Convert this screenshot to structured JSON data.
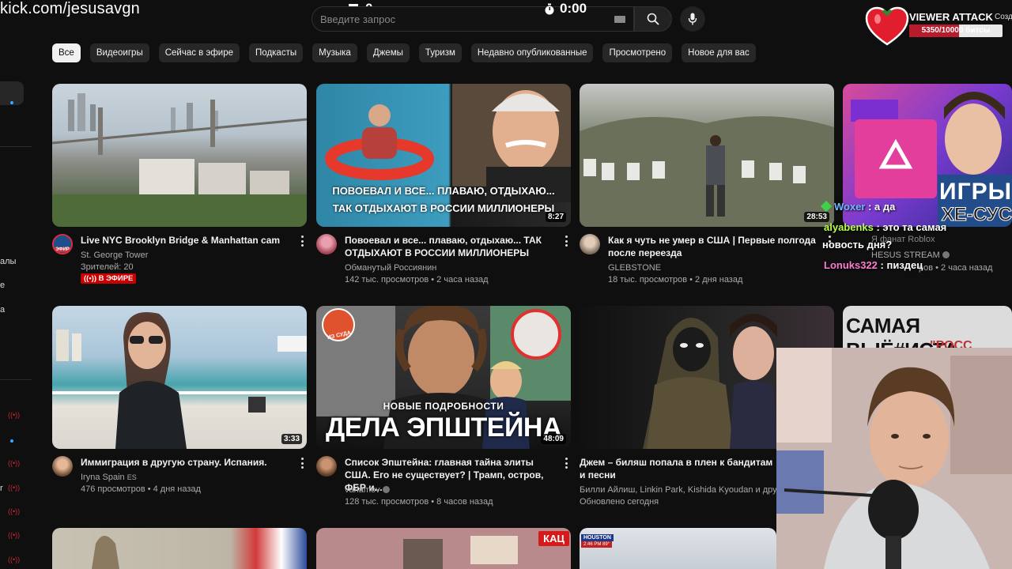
{
  "stream": {
    "channel_url": "kick.com/jesusavgn",
    "counter": "0",
    "timer": "0:00"
  },
  "search": {
    "placeholder": "Введите запрос"
  },
  "viewer_attack": {
    "title": "VIEWER ATTACK",
    "progress_text": "5350/10000 битсы",
    "progress": 0.535,
    "create_label": "Созд"
  },
  "sidebar": {
    "texts": [
      "алы",
      "е",
      "а",
      "r"
    ]
  },
  "chips": [
    "Все",
    "Видеоигры",
    "Сейчас в эфире",
    "Подкасты",
    "Музыка",
    "Джемы",
    "Туризм",
    "Недавно опубликованные",
    "Просмотрено",
    "Новое для вас"
  ],
  "videos": [
    {
      "title": "Live NYC Brooklyn Bridge & Manhattan cam",
      "channel": "St. George Tower",
      "stats": "Зрителей: 20",
      "badge": "В ЭФИРЕ",
      "avatar_badge": "ЭФИР",
      "duration": ""
    },
    {
      "title": "Повоевал и все... плаваю, отдыхаю... ТАК ОТДЫХАЮТ В РОССИИ МИЛЛИОНЕРЫ",
      "channel": "Обманутый Россиянин",
      "stats": "142 тыс. просмотров • 2 часа назад",
      "duration": "8:27",
      "overlay_line1": "ПОВОЕВАЛ И ВСЕ... ПЛАВАЮ, ОТДЫХАЮ...",
      "overlay_line2": "ТАК ОТДЫХАЮТ В РОССИИ МИЛЛИОНЕРЫ"
    },
    {
      "title": "Как я чуть не умер в США | Первые полгода после переезда",
      "channel": "GLEBSTONE",
      "stats": "18 тыс. просмотров • 2 дня назад",
      "duration": "28:53"
    },
    {
      "title": "",
      "channel": "HESUS STREAM",
      "stats": "ров • 2 часа назад",
      "category": "Я фанат Roblox",
      "overlay_line1": "ИГРЫ",
      "overlay_line2": "ХЕ-СУС"
    },
    {
      "title": "Иммиграция в другую страну. Испания.",
      "channel": "Iryna Spain",
      "channel_suffix": "ES",
      "stats": "476 просмотров • 4 дня назад",
      "duration": "3:33"
    },
    {
      "title": "Список Эпштейна: главная тайна элиты США. Его не существует? | Трамп, остров, ФБР и...",
      "channel": "varlamov",
      "stats": "128 тыс. просмотров • 8 часов назад",
      "duration": "48:09",
      "overlay_line1": "НОВЫЕ ПОДРОБНОСТИ",
      "overlay_line2": "ДЕЛА ЭПШТЕЙНА",
      "overlay_small": "ИЗ СУДА"
    },
    {
      "title": "Джем – биляш попала в плен к бандитам и песни",
      "channel": "Билли Айлиш, Linkin Park, Kishida Kyoudan и други",
      "stats": "Обновлено сегодня"
    },
    {
      "title": "",
      "overlay_line1": "САМАЯ ВЫЁ#ИСТА",
      "overlay_line2": "\"РОСС"
    },
    {
      "overlay_line1": ""
    },
    {
      "overlay_line1": "КАЦ"
    },
    {
      "overlay_line1": "HOUSTON",
      "overlay_line2": "2:46 PM    89°"
    }
  ],
  "chat": [
    {
      "user": "Woxer",
      "text": " : а да",
      "color": "#6fb6ff"
    },
    {
      "user": "alyabenks",
      "text": " : это та самая",
      "color": "#b6ff4f"
    },
    {
      "user": "",
      "text": "новость дня?",
      "color": "#ffffff"
    },
    {
      "user": "Lonuks322",
      "text": " : пиздец",
      "color": "#ff7ad0"
    }
  ]
}
